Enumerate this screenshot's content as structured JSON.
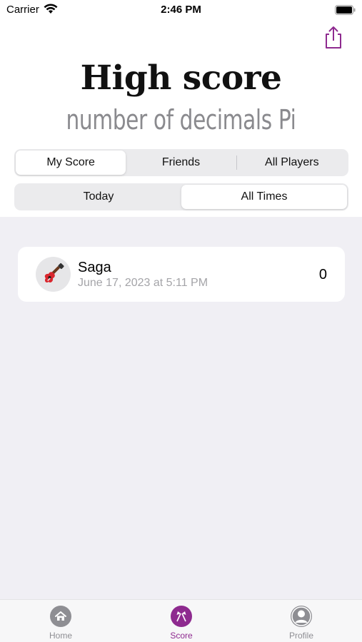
{
  "status_bar": {
    "carrier": "Carrier",
    "time": "2:46 PM"
  },
  "header": {
    "title": "High score",
    "subtitle": "number of decimals Pi",
    "share_icon": "share-icon"
  },
  "scope_tabs": {
    "items": [
      {
        "label": "My Score",
        "selected": true
      },
      {
        "label": "Friends",
        "selected": false
      },
      {
        "label": "All Players",
        "selected": false
      }
    ]
  },
  "period_tabs": {
    "items": [
      {
        "label": "Today",
        "selected": false
      },
      {
        "label": "All Times",
        "selected": true
      }
    ]
  },
  "scores": [
    {
      "avatar_icon": "guitar-icon",
      "name": "Saga",
      "date": "June 17, 2023 at 5:11 PM",
      "score": "0"
    }
  ],
  "tab_bar": {
    "items": [
      {
        "label": "Home",
        "icon": "home-icon",
        "active": false
      },
      {
        "label": "Score",
        "icon": "score-icon",
        "active": true
      },
      {
        "label": "Profile",
        "icon": "profile-icon",
        "active": false
      }
    ]
  },
  "colors": {
    "accent": "#8e2a8f",
    "inactive": "#8e8e93",
    "list_background": "#f0eff4"
  }
}
